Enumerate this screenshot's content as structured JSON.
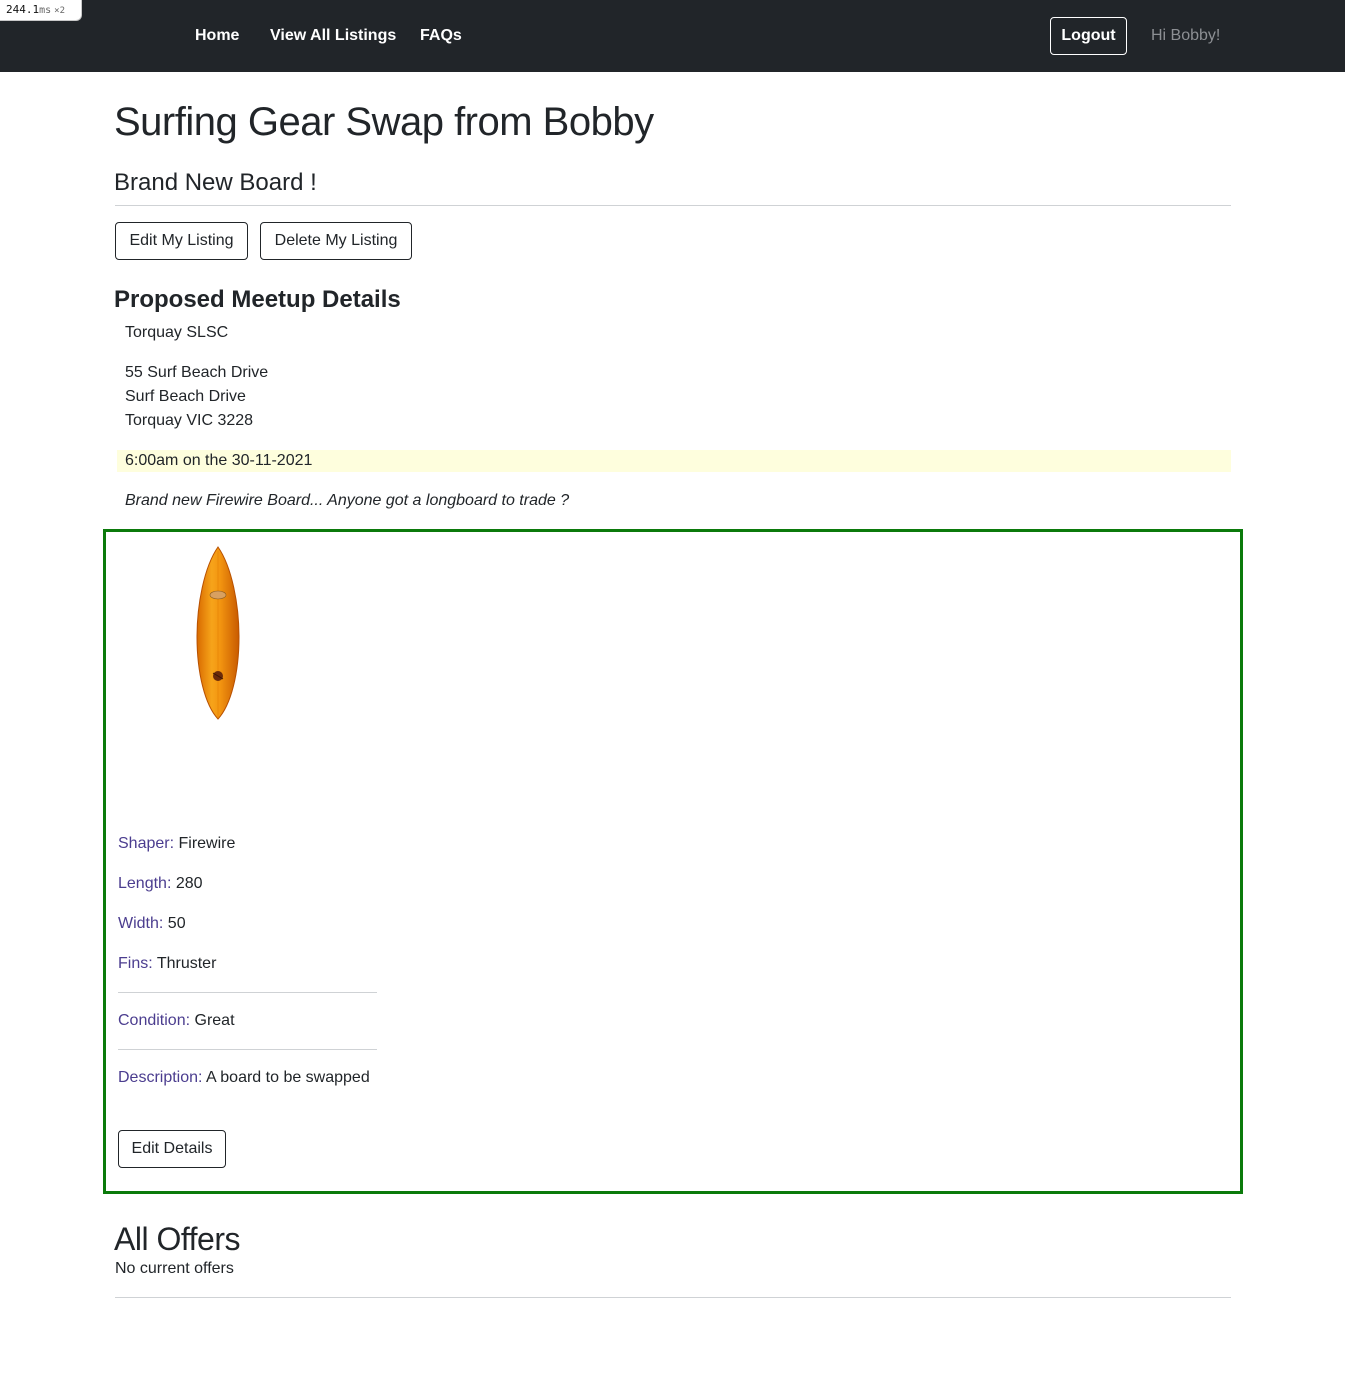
{
  "perf": {
    "value": "244.1",
    "unit": "ms",
    "multiplier": "×2"
  },
  "nav": {
    "links": [
      "Home",
      "View All Listings",
      "FAQs"
    ],
    "logout_label": "Logout",
    "greeting": "Hi Bobby!"
  },
  "page": {
    "title": "Surfing Gear Swap from Bobby",
    "listing_title": "Brand New Board !",
    "edit_listing_label": "Edit My Listing",
    "delete_listing_label": "Delete My Listing"
  },
  "meetup": {
    "heading": "Proposed Meetup Details",
    "venue": "Torquay SLSC",
    "address_lines": [
      "55 Surf Beach Drive",
      "Surf Beach Drive",
      "Torquay VIC 3228"
    ],
    "time": "6:00am on the 30-11-2021",
    "notes": "Brand new Firewire Board... Anyone got a longboard to trade ?"
  },
  "board": {
    "image": "surfboard-image",
    "specs": {
      "shaper": {
        "label": "Shaper:",
        "value": "Firewire"
      },
      "length": {
        "label": "Length:",
        "value": "280"
      },
      "width": {
        "label": "Width:",
        "value": "50"
      },
      "fins": {
        "label": "Fins:",
        "value": "Thruster"
      },
      "condition": {
        "label": "Condition:",
        "value": "Great"
      },
      "description": {
        "label": "Description:",
        "value": "A board to be swapped"
      }
    },
    "edit_details_label": "Edit Details"
  },
  "offers": {
    "heading": "All Offers",
    "empty_message": "No current offers"
  },
  "colors": {
    "navbar": "#212529",
    "card_border": "#0b7a0b",
    "time_highlight": "#fefedd",
    "spec_label": "#4b3d8f"
  }
}
